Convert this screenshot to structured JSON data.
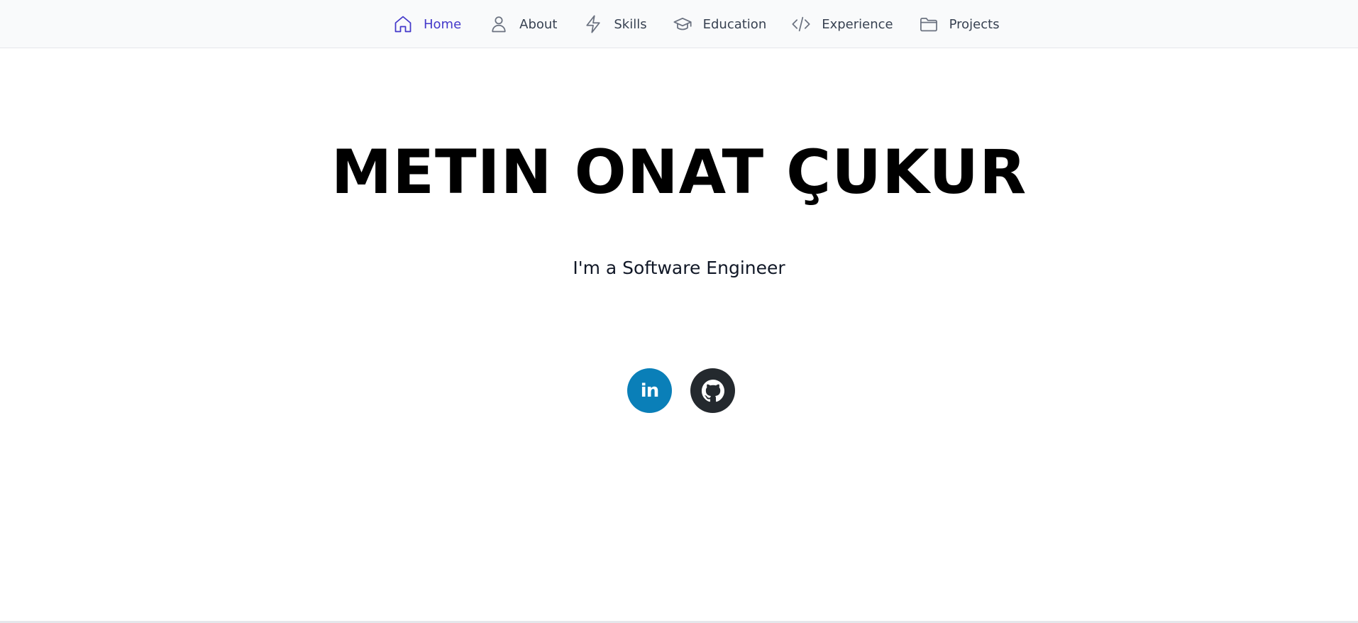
{
  "nav": {
    "items": [
      {
        "label": "Home",
        "icon": "home-icon",
        "active": true
      },
      {
        "label": "About",
        "icon": "user-icon",
        "active": false
      },
      {
        "label": "Skills",
        "icon": "lightning-icon",
        "active": false
      },
      {
        "label": "Education",
        "icon": "graduation-cap-icon",
        "active": false
      },
      {
        "label": "Experience",
        "icon": "code-icon",
        "active": false
      },
      {
        "label": "Projects",
        "icon": "folder-icon",
        "active": false
      }
    ]
  },
  "hero": {
    "title": "METIN ONAT ÇUKUR",
    "subtitle": "I'm a Software Engineer"
  },
  "social": {
    "linkedin_label": "in",
    "linkedin_icon": "linkedin-icon",
    "github_icon": "github-icon"
  },
  "colors": {
    "accent": "#4338ca",
    "linkedin": "#0a7fb8",
    "github": "#24292e",
    "nav_background": "#f9fafb"
  }
}
